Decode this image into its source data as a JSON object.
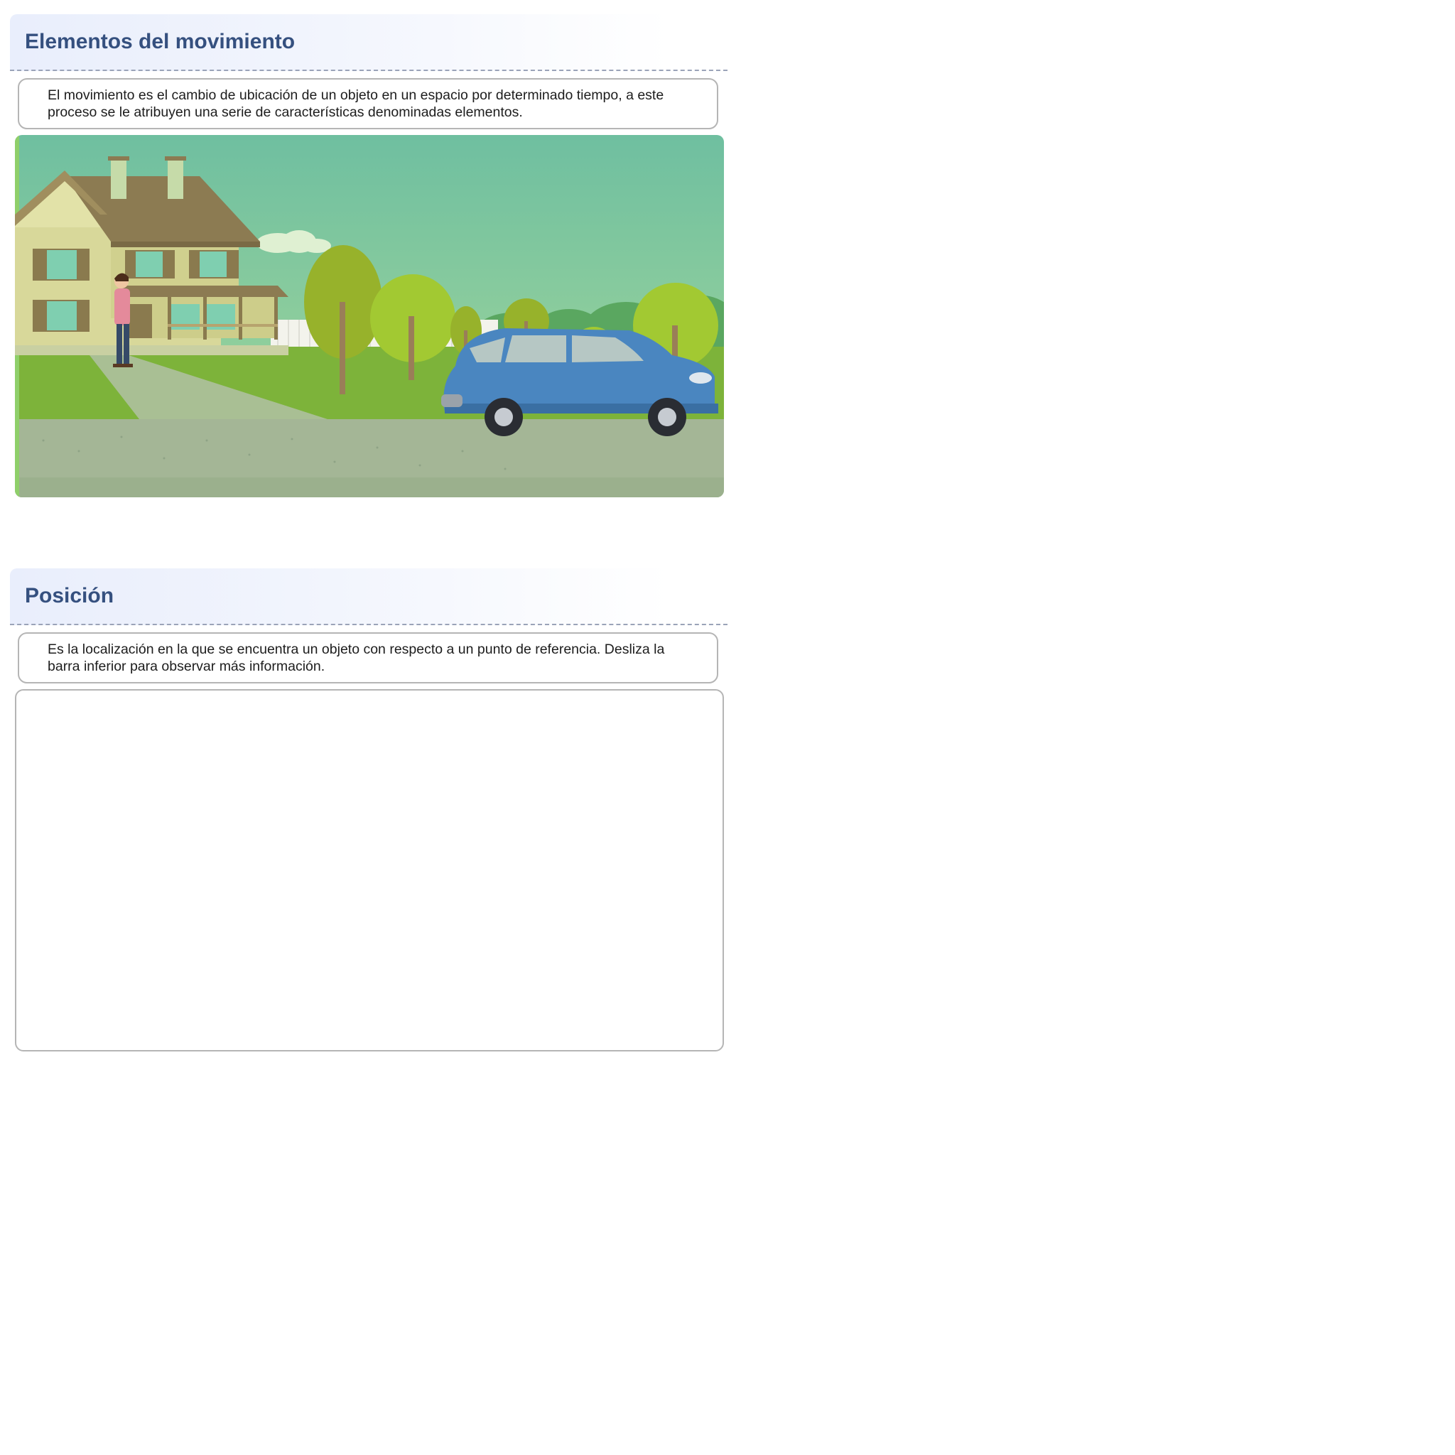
{
  "sections": [
    {
      "title": "Elementos del movimiento",
      "description": "El movimiento es el cambio de ubicación de un objeto en un espacio por determinado tiempo, a este proceso se le atribuyen una serie de características denominadas elementos."
    },
    {
      "title": "Posición",
      "description": "Es la localización en la que se encuentra un objeto con respecto a un punto de referencia. Desliza la barra inferior para observar más información."
    }
  ],
  "colors": {
    "title": "#35507f",
    "sky_top": "#6fbfa0",
    "grass": "#7db33a",
    "car": "#4a86c0"
  },
  "icons": [
    "house-illustration",
    "person-illustration",
    "tree-illustration",
    "car-illustration"
  ]
}
